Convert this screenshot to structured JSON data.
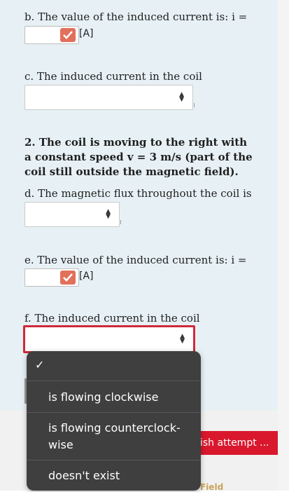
{
  "questions": {
    "b": {
      "label": "b. The value of the induced current is:  i =",
      "unit": "[A]"
    },
    "c": {
      "label": "c. The induced current in the coil"
    },
    "section2": {
      "text": "2. The coil is moving to the right with a constant speed v = 3 m/s (part of the coil still outside the magnetic field)."
    },
    "d": {
      "label": "d. The magnetic flux throughout the coil is"
    },
    "e": {
      "label": "e. The value of the induced current is:  i =",
      "unit": "[A]"
    },
    "f": {
      "label": "f. The induced current in the coil"
    }
  },
  "dropdown": {
    "options": [
      "is flowing clockwise",
      "is flowing counterclock-\nwise",
      "doesn't exist"
    ],
    "selected_index": 0
  },
  "finish_button": {
    "label": "ish attempt ..."
  },
  "partial_label": "Field",
  "colors": {
    "panel": "#e7f1f5",
    "error_border": "#d0283b",
    "finish": "#d9182d",
    "badge": "#e2705b"
  }
}
